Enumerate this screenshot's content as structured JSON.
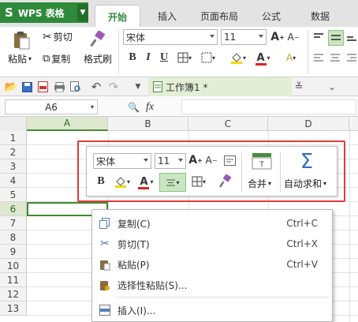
{
  "app": {
    "name": "WPS 表格",
    "logo_glyph": "S",
    "brand_color": "#2e8a3a"
  },
  "tabs": [
    {
      "label": "开始",
      "active": true
    },
    {
      "label": "插入",
      "active": false
    },
    {
      "label": "页面布局",
      "active": false
    },
    {
      "label": "公式",
      "active": false
    },
    {
      "label": "数据",
      "active": false
    }
  ],
  "ribbon": {
    "cut_label": "剪切",
    "copy_label": "复制",
    "paste_label": "粘贴",
    "format_painter_label": "格式刷",
    "font_name": "宋体",
    "font_size": "11",
    "bold": "B",
    "italic": "I",
    "underline": "U",
    "font_color_letter": "A"
  },
  "document": {
    "tab_title": "工作簿1 *"
  },
  "formula_bar": {
    "cell_ref": "A6",
    "fx_label": "fx"
  },
  "grid": {
    "columns": [
      "A",
      "B",
      "C",
      "D"
    ],
    "rows": [
      "1",
      "2",
      "3",
      "4",
      "5",
      "6",
      "7",
      "8",
      "9",
      "10",
      "11",
      "12",
      "13"
    ],
    "selected_cell": "A6"
  },
  "mini_toolbar": {
    "font_name": "宋体",
    "font_size": "11",
    "bold": "B",
    "font_color_letter": "A",
    "merge_label": "合并",
    "autosum_label": "自动求和",
    "autosum_glyph": "Σ",
    "highlight_color": "#e23b3b"
  },
  "context_menu": {
    "items": [
      {
        "label": "复制(C)",
        "shortcut": "Ctrl+C",
        "icon": "copy-icon"
      },
      {
        "label": "剪切(T)",
        "shortcut": "Ctrl+X",
        "icon": "cut-icon"
      },
      {
        "label": "粘贴(P)",
        "shortcut": "Ctrl+V",
        "icon": "paste-icon"
      },
      {
        "label": "选择性粘贴(S)...",
        "shortcut": "",
        "icon": "paste-special-icon"
      },
      {
        "label": "插入(I)...",
        "shortcut": "",
        "icon": "insert-icon"
      }
    ]
  }
}
